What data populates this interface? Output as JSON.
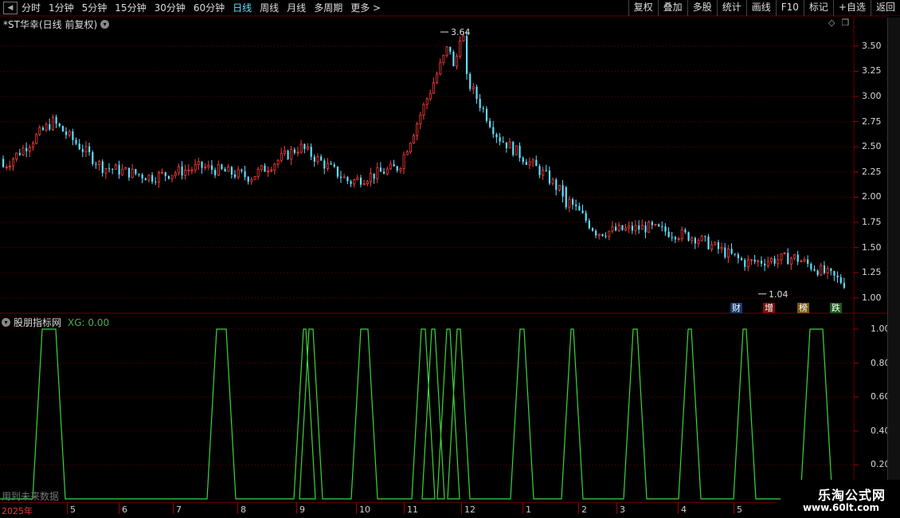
{
  "toolbar": {
    "periods": [
      "分时",
      "1分钟",
      "5分钟",
      "15分钟",
      "30分钟",
      "60分钟",
      "日线",
      "周线",
      "月线",
      "多周期",
      "更多 >"
    ],
    "active_period": "日线",
    "actions": [
      "复权",
      "叠加",
      "多股",
      "统计",
      "画线",
      "F10",
      "标记",
      "+自选",
      "返回"
    ]
  },
  "price_panel": {
    "title": "*ST华幸(日线 前复权)",
    "high_label": "3.64",
    "low_label": "1.04",
    "yaxis_ticks": [
      "3.50",
      "3.25",
      "3.00",
      "2.75",
      "2.50",
      "2.25",
      "2.00",
      "1.75",
      "1.50",
      "1.25",
      "1.00"
    ],
    "event_tags": [
      "财",
      "增",
      "榜",
      "跌"
    ]
  },
  "indicator_panel": {
    "name": "股朋指标网",
    "value_label": "XG: 0.00",
    "yaxis_ticks": [
      "1.00",
      "0.80",
      "0.60",
      "0.40",
      "0.20"
    ]
  },
  "xaxis": {
    "year_label": "2025年",
    "months": [
      "5",
      "6",
      "7",
      "8",
      "9",
      "10",
      "11",
      "12",
      "1",
      "2",
      "3",
      "4",
      "5"
    ]
  },
  "watermark": "用到未来数据",
  "brand": {
    "name": "乐淘公式网",
    "url": "www.60lt.com"
  },
  "colors": {
    "up": "#ff3b3b",
    "down": "#5ee0ff",
    "indicator": "#3cd63c",
    "grid": "#6b0000"
  },
  "chart_data": [
    {
      "type": "candlestick",
      "title": "*ST华幸(日线 前复权)",
      "ylim": [
        0.92,
        3.72
      ],
      "yticks": [
        1.0,
        1.25,
        1.5,
        1.75,
        2.0,
        2.25,
        2.5,
        2.75,
        3.0,
        3.25,
        3.5
      ],
      "annotations": [
        {
          "label": "3.64",
          "value": 3.64
        },
        {
          "label": "1.04",
          "value": 1.04
        }
      ],
      "approx_close_trend": [
        {
          "month": "2025-04",
          "close": 2.3
        },
        {
          "month": "2025-05",
          "close": 2.75
        },
        {
          "month": "2025-05",
          "close": 2.3
        },
        {
          "month": "2025-06",
          "close": 2.2
        },
        {
          "month": "2025-07",
          "close": 2.3
        },
        {
          "month": "2025-08",
          "close": 2.2
        },
        {
          "month": "2025-09",
          "close": 2.5
        },
        {
          "month": "2025-10",
          "close": 2.15
        },
        {
          "month": "2025-11",
          "close": 2.3
        },
        {
          "month": "2025-11",
          "close": 3.5
        },
        {
          "month": "2025-12",
          "close": 2.6
        },
        {
          "month": "2025-12",
          "close": 2.2
        },
        {
          "month": "2026-01",
          "close": 1.65
        },
        {
          "month": "2026-02",
          "close": 1.7
        },
        {
          "month": "2026-03",
          "close": 1.6
        },
        {
          "month": "2026-04",
          "close": 1.35
        },
        {
          "month": "2026-05",
          "close": 1.4
        },
        {
          "month": "2026-05",
          "close": 1.15
        }
      ]
    },
    {
      "type": "line",
      "name": "XG",
      "ylim": [
        0,
        1
      ],
      "yticks": [
        0.2,
        0.4,
        0.6,
        0.8,
        1.0
      ],
      "signal_windows": [
        [
          5,
          22
        ],
        [
          224,
          236
        ],
        [
          333,
          336
        ],
        [
          340,
          345
        ],
        [
          405,
          414
        ],
        [
          481,
          486
        ],
        [
          494,
          498
        ],
        [
          513,
          517
        ],
        [
          526,
          530
        ],
        [
          605,
          610
        ],
        [
          669,
          672
        ],
        [
          747,
          752
        ],
        [
          816,
          820
        ],
        [
          885,
          889
        ],
        [
          969,
          985
        ]
      ]
    }
  ]
}
